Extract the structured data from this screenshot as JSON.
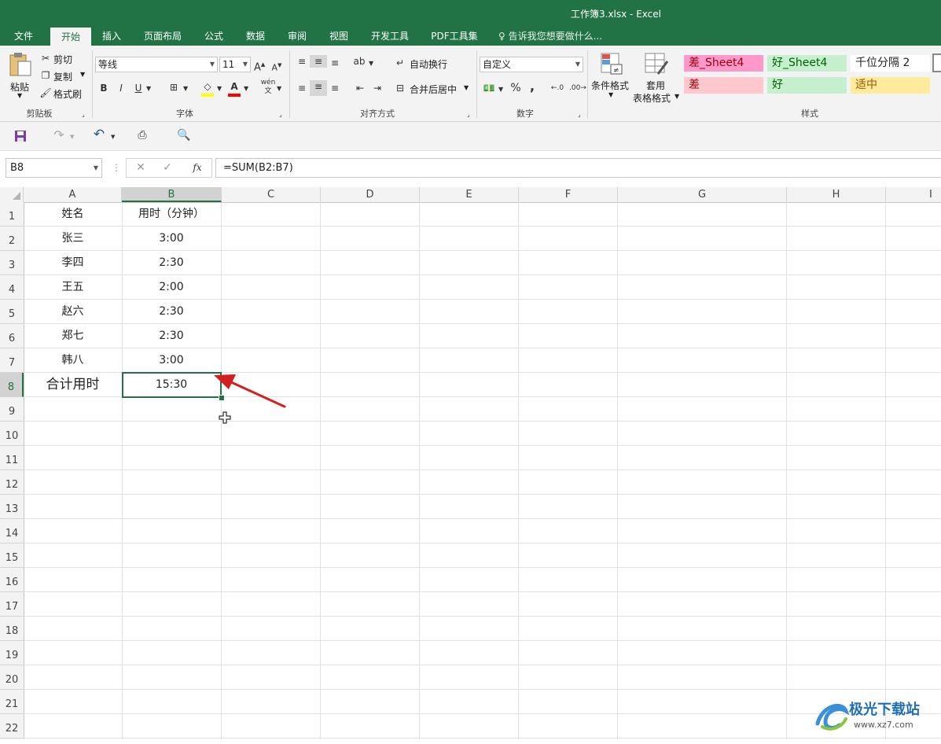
{
  "window": {
    "title": "工作簿3.xlsx - Excel"
  },
  "tabs": [
    "文件",
    "开始",
    "插入",
    "页面布局",
    "公式",
    "数据",
    "审阅",
    "视图",
    "开发工具",
    "PDF工具集"
  ],
  "active_tab": "开始",
  "tell_me": "告诉我您想要做什么...",
  "ribbon": {
    "clipboard": {
      "paste": "粘贴",
      "cut": "剪切",
      "copy": "复制",
      "format_painter": "格式刷",
      "label": "剪贴板"
    },
    "font": {
      "name": "等线",
      "size": "11",
      "bold": "B",
      "italic": "I",
      "underline": "U",
      "label": "字体",
      "grow": "A",
      "shrink": "A",
      "phonetic": "wén"
    },
    "alignment": {
      "wrap": "自动换行",
      "merge": "合并后居中",
      "label": "对齐方式"
    },
    "number": {
      "format": "自定义",
      "percent": "%",
      "comma": ",",
      "label": "数字"
    },
    "styles_buttons": {
      "conditional": "条件格式",
      "table_line1": "套用",
      "table_line2": "表格格式"
    },
    "styles": {
      "label": "样式",
      "cells": [
        {
          "text": "差_Sheet4",
          "bg": "#ff99cc",
          "fg": "#9c0006"
        },
        {
          "text": "好_Sheet4",
          "bg": "#c6efce",
          "fg": "#006100"
        },
        {
          "text": "千位分隔 2",
          "bg": "#ffffff",
          "fg": "#222222"
        },
        {
          "text": "差",
          "bg": "#ffc7ce",
          "fg": "#9c0006"
        },
        {
          "text": "好",
          "bg": "#c6efce",
          "fg": "#006100"
        },
        {
          "text": "适中",
          "bg": "#ffeb9c",
          "fg": "#9c5700"
        }
      ]
    }
  },
  "formula_bar": {
    "name_box": "B8",
    "formula": "=SUM(B2:B7)",
    "fx": "fx"
  },
  "columns": [
    "A",
    "B",
    "C",
    "D",
    "E",
    "F",
    "G",
    "H",
    "I"
  ],
  "rows": [
    "1",
    "2",
    "3",
    "4",
    "5",
    "6",
    "7",
    "8",
    "9",
    "10",
    "11",
    "12",
    "13",
    "14",
    "15",
    "16",
    "17",
    "18",
    "19",
    "20",
    "21",
    "22"
  ],
  "sheet": {
    "header": {
      "a": "姓名",
      "b": "用时（分钟）"
    },
    "data": [
      {
        "a": "张三",
        "b": "3:00"
      },
      {
        "a": "李四",
        "b": "2:30"
      },
      {
        "a": "王五",
        "b": "2:00"
      },
      {
        "a": "赵六",
        "b": "2:30"
      },
      {
        "a": "郑七",
        "b": "2:30"
      },
      {
        "a": "韩八",
        "b": "3:00"
      }
    ],
    "total": {
      "a": "合计用时",
      "b": "15:30"
    }
  },
  "selected_cell": "B8",
  "colors": {
    "brand": "#217346",
    "arrow": "#d42020"
  },
  "watermark": {
    "text": "极光下载站",
    "url": "www.xz7.com"
  }
}
